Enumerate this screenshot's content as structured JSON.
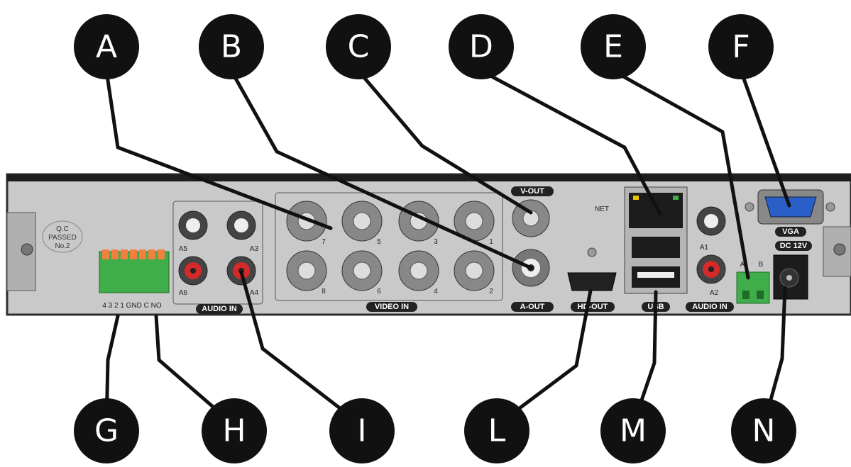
{
  "callouts": {
    "A": "A",
    "B": "B",
    "C": "C",
    "D": "D",
    "E": "E",
    "F": "F",
    "G": "G",
    "H": "H",
    "I": "I",
    "L": "L",
    "M": "M",
    "N": "N"
  },
  "panel": {
    "qc_text": [
      "Q.C",
      "PASSED",
      "No.2"
    ],
    "alarm_terminal_label": "4 3 2 1 GND C NO",
    "audio_in_label": "AUDIO IN",
    "audio_in_right_label": "AUDIO IN",
    "audio_port_labels": [
      "A5",
      "A3",
      "A6",
      "A4",
      "A1",
      "A2"
    ],
    "video_in_label": "VIDEO IN",
    "video_port_numbers": [
      "7",
      "5",
      "3",
      "1",
      "8",
      "6",
      "4",
      "2"
    ],
    "v_out_label": "V-OUT",
    "a_out_label": "A-OUT",
    "hd_out_label": "HD-OUT",
    "net_label": "NET",
    "usb_label": "USB",
    "rs485_labels": [
      "A",
      "B"
    ],
    "vga_label": "VGA",
    "dc_label": "DC 12V"
  },
  "colors": {
    "callout_fill": "#111111",
    "panel_fill": "#c8c8c8",
    "panel_border": "#333333",
    "terminal_green": "#3fae4a",
    "terminal_orange": "#f08040",
    "rca_red": "#d42a2a",
    "vga_blue": "#2b5fc8"
  }
}
